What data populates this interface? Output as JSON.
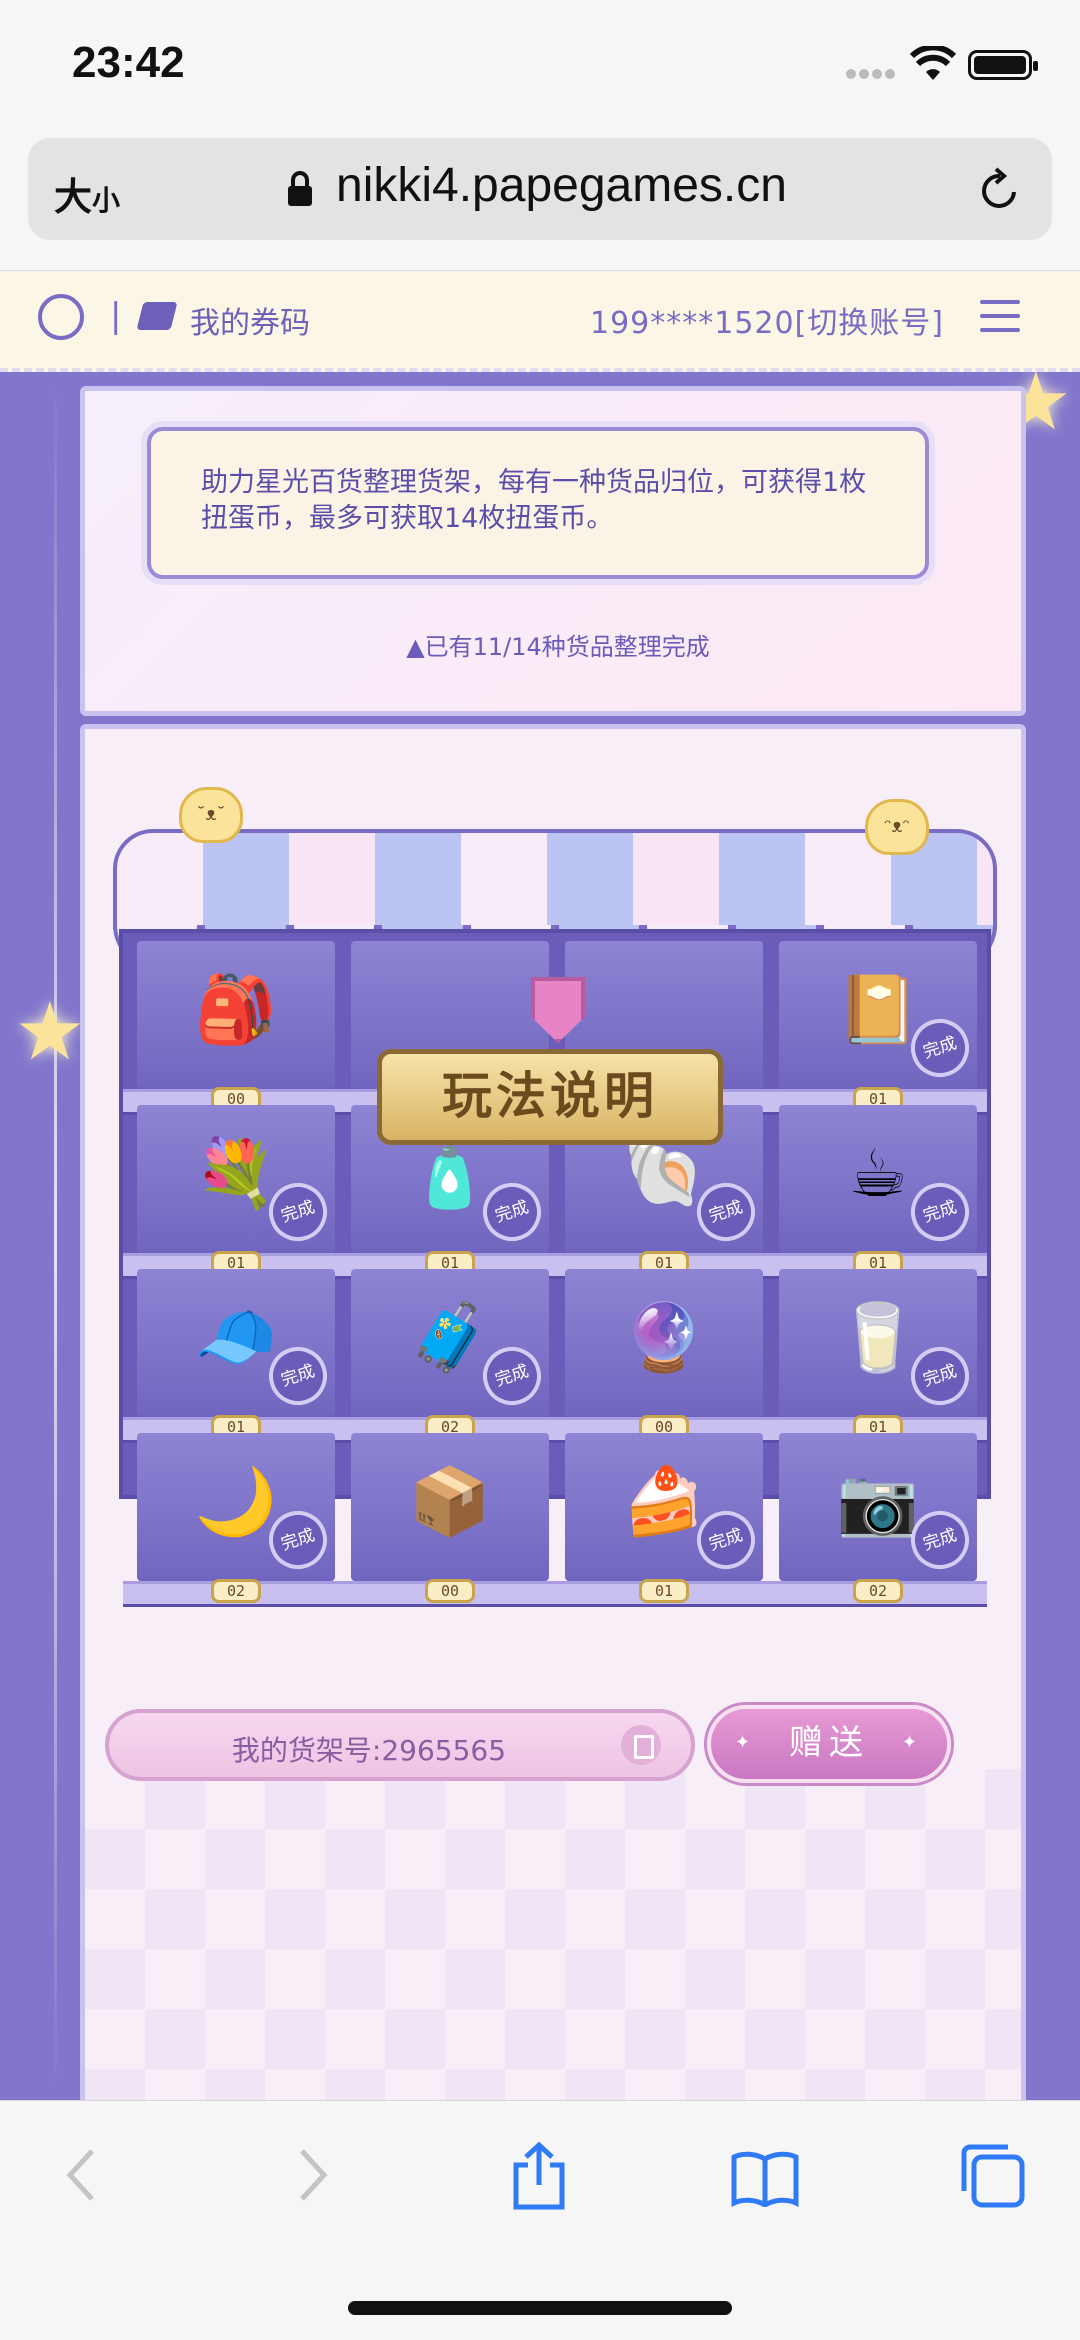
{
  "status_bar": {
    "time": "23:42"
  },
  "browser": {
    "text_size_label": "大",
    "text_size_small": "小",
    "domain": "nikki4.papegames.cn"
  },
  "site_header": {
    "separator": "|",
    "coupons_label": "我的券码",
    "account": "199****1520[切换账号]"
  },
  "notice": {
    "text": "助力星光百货整理货架，每有一种货品归位，可获得1枚扭蛋币，最多可获取14枚扭蛋币。",
    "progress": "▲已有11/14种货品整理完成"
  },
  "shelf": {
    "rules_button": "玩法说明",
    "items": [
      {
        "name": "backpack",
        "icon": "🎒",
        "count": "00",
        "done": false
      },
      {
        "name": "photo-album",
        "icon": "📔",
        "count": "01",
        "done": true,
        "badge": "完成"
      },
      {
        "name": "flower-basket",
        "icon": "💐",
        "count": "01",
        "done": true,
        "badge": "完成"
      },
      {
        "name": "perfume",
        "icon": "🧴",
        "count": "01",
        "done": true,
        "badge": "完成"
      },
      {
        "name": "shell-ring",
        "icon": "🐚",
        "count": "01",
        "done": true,
        "badge": "完成"
      },
      {
        "name": "bunny-cup",
        "icon": "☕",
        "count": "01",
        "done": true,
        "badge": "完成"
      },
      {
        "name": "cat-hat",
        "icon": "🧢",
        "count": "01",
        "done": true,
        "badge": "完成"
      },
      {
        "name": "suitcase",
        "icon": "🧳",
        "count": "02",
        "done": true,
        "badge": "完成"
      },
      {
        "name": "crystal-ball",
        "icon": "🔮",
        "count": "00",
        "done": false
      },
      {
        "name": "milk-box",
        "icon": "🥛",
        "count": "01",
        "done": true,
        "badge": "完成"
      },
      {
        "name": "moon-pillow",
        "icon": "🌙",
        "count": "02",
        "done": true,
        "badge": "完成"
      },
      {
        "name": "nikki-box",
        "icon": "📦",
        "count": "00",
        "done": false
      },
      {
        "name": "cake",
        "icon": "🍰",
        "count": "01",
        "done": true,
        "badge": "完成"
      },
      {
        "name": "camera",
        "icon": "📷",
        "count": "02",
        "done": true,
        "badge": "完成"
      }
    ]
  },
  "footer_actions": {
    "shelf_id_label": "我的货架号:2965565",
    "gift_button": "赠送"
  },
  "colors": {
    "accent": "#7a6cc2",
    "shelf": "#6a5cb8",
    "pink": "#e79ad4",
    "gold": "#d9b466"
  }
}
